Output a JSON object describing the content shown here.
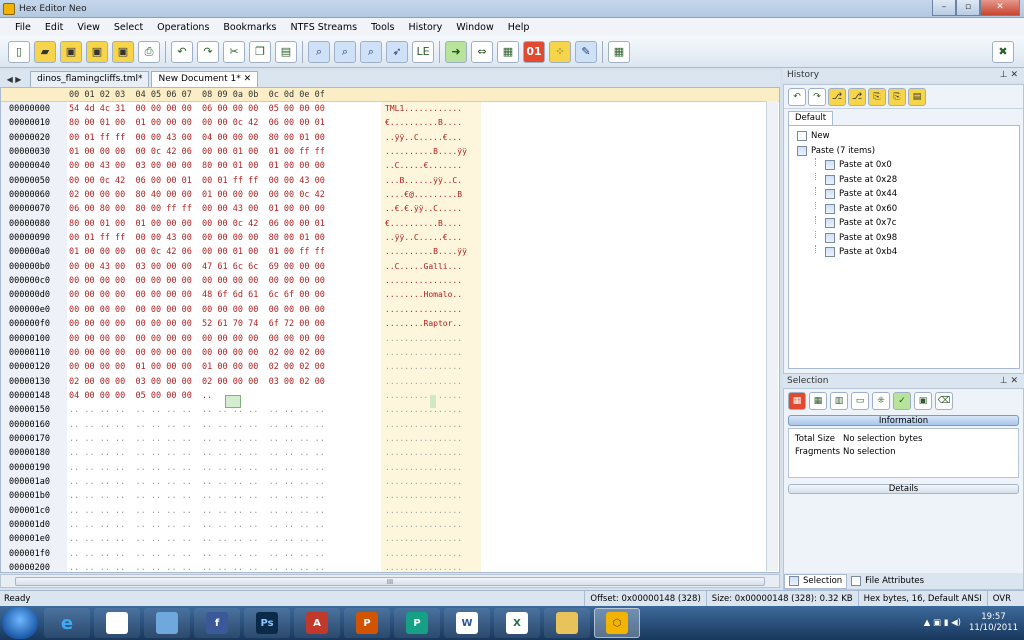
{
  "window": {
    "title": "Hex Editor Neo"
  },
  "menu": [
    "File",
    "Edit",
    "View",
    "Select",
    "Operations",
    "Bookmarks",
    "NTFS Streams",
    "Tools",
    "History",
    "Window",
    "Help"
  ],
  "tabs": [
    {
      "label": "dinos_flamingcliffs.tml*"
    },
    {
      "label": "New Document 1*"
    }
  ],
  "hex_header": "00 01 02 03  04 05 06 07  08 09 0a 0b  0c 0d 0e 0f",
  "offsets": [
    "00000000",
    "00000010",
    "00000020",
    "00000030",
    "00000040",
    "00000050",
    "00000060",
    "00000070",
    "00000080",
    "00000090",
    "000000a0",
    "000000b0",
    "000000c0",
    "000000d0",
    "000000e0",
    "000000f0",
    "00000100",
    "00000110",
    "00000120",
    "00000130",
    "00000148",
    "00000150",
    "00000160",
    "00000170",
    "00000180",
    "00000190",
    "000001a0",
    "000001b0",
    "000001c0",
    "000001d0",
    "000001e0",
    "000001f0",
    "00000200"
  ],
  "hex_rows": [
    "54 4d 4c 31  00 00 00 00  06 00 00 00  05 00 00 00",
    "80 00 01 00  01 00 00 00  00 00 0c 42  06 00 00 01",
    "00 01 ff ff  00 00 43 00  04 00 00 00  80 00 01 00",
    "01 00 00 00  00 0c 42 06  00 00 01 00  01 00 ff ff",
    "00 00 43 00  03 00 00 00  80 00 01 00  01 00 00 00",
    "00 00 0c 42  06 00 00 01  00 01 ff ff  00 00 43 00",
    "02 00 00 00  80 40 00 00  01 00 00 00  00 00 0c 42",
    "06 00 80 00  80 00 ff ff  00 00 43 00  01 00 00 00",
    "80 00 01 00  01 00 00 00  00 00 0c 42  06 00 00 01",
    "00 01 ff ff  00 00 43 00  00 00 00 00  80 00 01 00",
    "01 00 00 00  00 0c 42 06  00 00 01 00  01 00 ff ff",
    "00 00 43 00  03 00 00 00  47 61 6c 6c  69 00 00 00",
    "00 00 00 00  00 00 00 00  00 00 00 00  00 00 00 00",
    "00 00 00 00  00 00 00 00  48 6f 6d 61  6c 6f 00 00",
    "00 00 00 00  00 00 00 00  00 00 00 00  00 00 00 00",
    "00 00 00 00  00 00 00 00  52 61 70 74  6f 72 00 00",
    "00 00 00 00  00 00 00 00  00 00 00 00  00 00 00 00",
    "00 00 00 00  00 00 00 00  00 00 00 00  02 00 02 00",
    "00 00 00 00  01 00 00 00  01 00 00 00  02 00 02 00",
    "02 00 00 00  03 00 00 00  02 00 00 00  03 00 02 00",
    "04 00 00 00  05 00 00 00  ..",
    ".. .. .. ..  .. .. .. ..  .. .. .. ..  .. .. .. ..",
    ".. .. .. ..  .. .. .. ..  .. .. .. ..  .. .. .. ..",
    ".. .. .. ..  .. .. .. ..  .. .. .. ..  .. .. .. ..",
    ".. .. .. ..  .. .. .. ..  .. .. .. ..  .. .. .. ..",
    ".. .. .. ..  .. .. .. ..  .. .. .. ..  .. .. .. ..",
    ".. .. .. ..  .. .. .. ..  .. .. .. ..  .. .. .. ..",
    ".. .. .. ..  .. .. .. ..  .. .. .. ..  .. .. .. ..",
    ".. .. .. ..  .. .. .. ..  .. .. .. ..  .. .. .. ..",
    ".. .. .. ..  .. .. .. ..  .. .. .. ..  .. .. .. ..",
    ".. .. .. ..  .. .. .. ..  .. .. .. ..  .. .. .. ..",
    ".. .. .. ..  .. .. .. ..  .. .. .. ..  .. .. .. ..",
    ".. .. .. ..  .. .. .. ..  .. .. .. ..  .. .. .. .."
  ],
  "text_rows": [
    "TML1............",
    "€..........B....",
    "..ÿÿ..C.....€...",
    "..........B....ÿÿ",
    "..C.....€.......",
    "...B......ÿÿ..C.",
    "....€@.........B",
    "..€.€.ÿÿ..C.....",
    "€..........B....",
    "..ÿÿ..C.....€...",
    "..........B....ÿÿ",
    "..C.....Galli...",
    "................",
    "........Homalo..",
    "................",
    "........Raptor..",
    "................",
    "................",
    "................",
    "................",
    "................",
    "................",
    "................",
    "................",
    "................",
    "................",
    "................",
    "................",
    "................",
    "................",
    "................",
    "................",
    "................"
  ],
  "history": {
    "title": "History",
    "tab": "Default",
    "items": [
      "New",
      "Paste (7 items)"
    ],
    "sub_items": [
      "Paste at 0x0",
      "Paste at 0x28",
      "Paste at 0x44",
      "Paste at 0x60",
      "Paste at 0x7c",
      "Paste at 0x98",
      "Paste at 0xb4"
    ]
  },
  "selection": {
    "title": "Selection",
    "information_label": "Information",
    "total_size_label": "Total Size",
    "total_size_value": "No selection",
    "total_size_unit": "bytes",
    "fragments_label": "Fragments",
    "fragments_value": "No selection",
    "details_label": "Details",
    "tabs": [
      "Selection",
      "File Attributes"
    ]
  },
  "status": {
    "left": "Ready",
    "offset": "Offset: 0x00000148 (328)",
    "size": "Size: 0x00000148 (328): 0.32 KB",
    "mode": "Hex bytes, 16, Default ANSI",
    "ovr": "OVR"
  },
  "taskbar": {
    "time": "19:57",
    "date": "11/10/2011"
  }
}
